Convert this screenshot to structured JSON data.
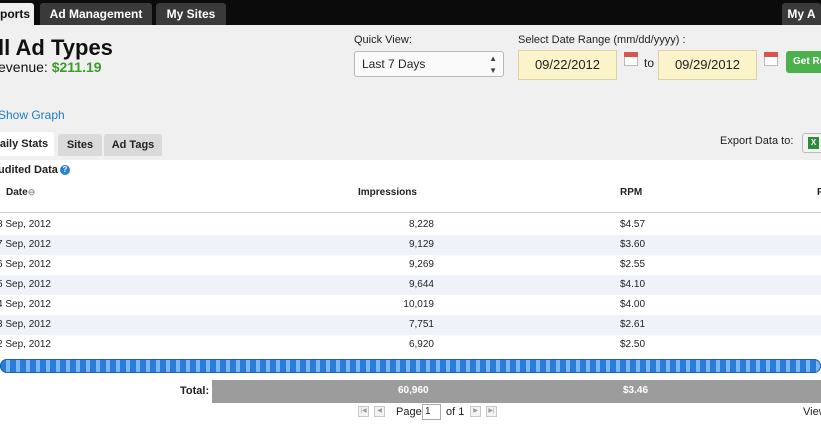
{
  "nav": {
    "tabs": [
      {
        "label": "ports"
      },
      {
        "label": "Ad Management"
      },
      {
        "label": "My Sites"
      },
      {
        "label": "My A"
      }
    ]
  },
  "header": {
    "title": "ll Ad Types",
    "revenue_label": "evenue:",
    "revenue_value": "$211.19",
    "quick_view_label": "Quick View:",
    "quick_view_value": "Last 7 Days",
    "date_range_label": "Select Date Range (mm/dd/yyyy) :",
    "start_date": "09/22/2012",
    "to_label": "to",
    "end_date": "09/29/2012",
    "get_button": "Get Re",
    "show_graph": "Show Graph"
  },
  "subtabs": [
    {
      "label": "aily Stats"
    },
    {
      "label": "Sites"
    },
    {
      "label": "Ad Tags"
    }
  ],
  "export_label": "Export Data to:",
  "table": {
    "section_label": "udited Data",
    "columns": {
      "date": "Date",
      "impressions": "Impressions",
      "rpm": "RPM",
      "extra": "F"
    },
    "rows": [
      {
        "date": "8 Sep, 2012",
        "impressions": "8,228",
        "rpm": "$4.57"
      },
      {
        "date": "7 Sep, 2012",
        "impressions": "9,129",
        "rpm": "$3.60"
      },
      {
        "date": "6 Sep, 2012",
        "impressions": "9,269",
        "rpm": "$2.55"
      },
      {
        "date": "5 Sep, 2012",
        "impressions": "9,644",
        "rpm": "$4.10"
      },
      {
        "date": "4 Sep, 2012",
        "impressions": "10,019",
        "rpm": "$4.00"
      },
      {
        "date": "3 Sep, 2012",
        "impressions": "7,751",
        "rpm": "$2.61"
      },
      {
        "date": "2 Sep, 2012",
        "impressions": "6,920",
        "rpm": "$2.50"
      }
    ],
    "total_label": "Total:",
    "total_impressions": "60,960",
    "total_rpm": "$3.46"
  },
  "pagination": {
    "page_label": "Page",
    "page_value": "1",
    "of_label": "of 1",
    "view_label": "View"
  },
  "colors": {
    "revenue": "#3a9b2a",
    "link": "#1f7fc4",
    "accent_button": "#4cb04c"
  }
}
